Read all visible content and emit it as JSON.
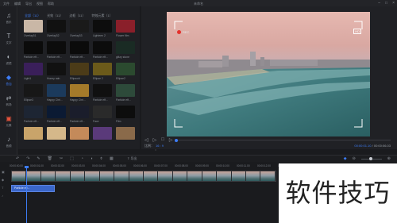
{
  "titlebar": {
    "menu": [
      "文件",
      "编辑",
      "导出",
      "视图",
      "帮助"
    ],
    "title": "未命名"
  },
  "sidebar": {
    "items": [
      {
        "icon": "music-icon",
        "label": "音乐"
      },
      {
        "icon": "text-icon",
        "label": "文字"
      },
      {
        "icon": "filter-icon",
        "label": "滤镜"
      },
      {
        "icon": "overlay-icon",
        "label": "叠加"
      },
      {
        "icon": "transition-icon",
        "label": "转场"
      },
      {
        "icon": "element-icon",
        "label": "元素"
      },
      {
        "icon": "audio-icon",
        "label": "音频"
      }
    ]
  },
  "library": {
    "tabs": [
      "全部（11）",
      "光效（11）",
      "边框（11）",
      "特效元素（1）"
    ],
    "items": [
      {
        "label": "Overlay31",
        "color": "#c9b7a6"
      },
      {
        "label": "Overlay32",
        "color": "#111"
      },
      {
        "label": "Overlay33",
        "color": "#1a1a1a"
      },
      {
        "label": "Lighteen 2",
        "color": "#0d0d0d"
      },
      {
        "label": "Flower film",
        "color": "#8a1f2a"
      },
      {
        "label": "Particle eff...",
        "color": "#0b0b0b"
      },
      {
        "label": "Particle eff...",
        "color": "#0c0c0c"
      },
      {
        "label": "Particle eff...",
        "color": "#0b0b0b"
      },
      {
        "label": "Particle eff...",
        "color": "#0c0c0c"
      },
      {
        "label": "glitzy stone",
        "color": "#1a2b24"
      },
      {
        "label": "Light1",
        "color": "#3a1f5a"
      },
      {
        "label": "Honey rain",
        "color": "#111"
      },
      {
        "label": "Ellipsoid",
        "color": "#4b3b18"
      },
      {
        "label": "Ellipse 2",
        "color": "#6b5a1a"
      },
      {
        "label": "Ellipse2",
        "color": "#2b4a2f"
      },
      {
        "label": "Ellipse3",
        "color": "#171717"
      },
      {
        "label": "Happy Chri...",
        "color": "#1b3a5c"
      },
      {
        "label": "Happy Chri...",
        "color": "#a47a2a"
      },
      {
        "label": "Particle eff...",
        "color": "#101010"
      },
      {
        "label": "Particle eff...",
        "color": "#2d4a3a"
      },
      {
        "label": "Particle eff...",
        "color": "#1d2533"
      },
      {
        "label": "Particle eff...",
        "color": "#0b1a33"
      },
      {
        "label": "Particle eff...",
        "color": "#1a1d2b"
      },
      {
        "label": "Face",
        "color": "#2a2a2a"
      },
      {
        "label": "Film",
        "color": "#0d0d0d"
      },
      {
        "label": "",
        "color": "#c9a46a"
      },
      {
        "label": "",
        "color": "#d5b88a"
      },
      {
        "label": "",
        "color": "#c48a5a"
      },
      {
        "label": "",
        "color": "#5a3a7a"
      },
      {
        "label": "",
        "color": "#8a6a4a"
      }
    ]
  },
  "preview": {
    "rec_label": "REC",
    "resolution": "HD",
    "ratio_label": "比例：",
    "ratio_value": "16 : 9",
    "current_time": "00:00:01.10",
    "total_time": "/ 00:00:06.03"
  },
  "toolbar": {
    "export_label": "导出"
  },
  "timeline": {
    "ticks": [
      "00:00:00.00",
      "00:00:01.00",
      "00:00:02.00",
      "00:00:03.00",
      "00:00:04.00",
      "00:00:05.00",
      "00:00:06.00",
      "00:00:07.00",
      "00:00:08.00",
      "00:00:09.00",
      "00:00:10.00",
      "00:00:11.00",
      "00:00:12.00",
      "00:00:13.00"
    ],
    "overlay_clip_label": "Particle eff..."
  },
  "watermark": "软件技巧",
  "colors": {
    "accent": "#3d7cf5",
    "rec": "#e5302b"
  }
}
